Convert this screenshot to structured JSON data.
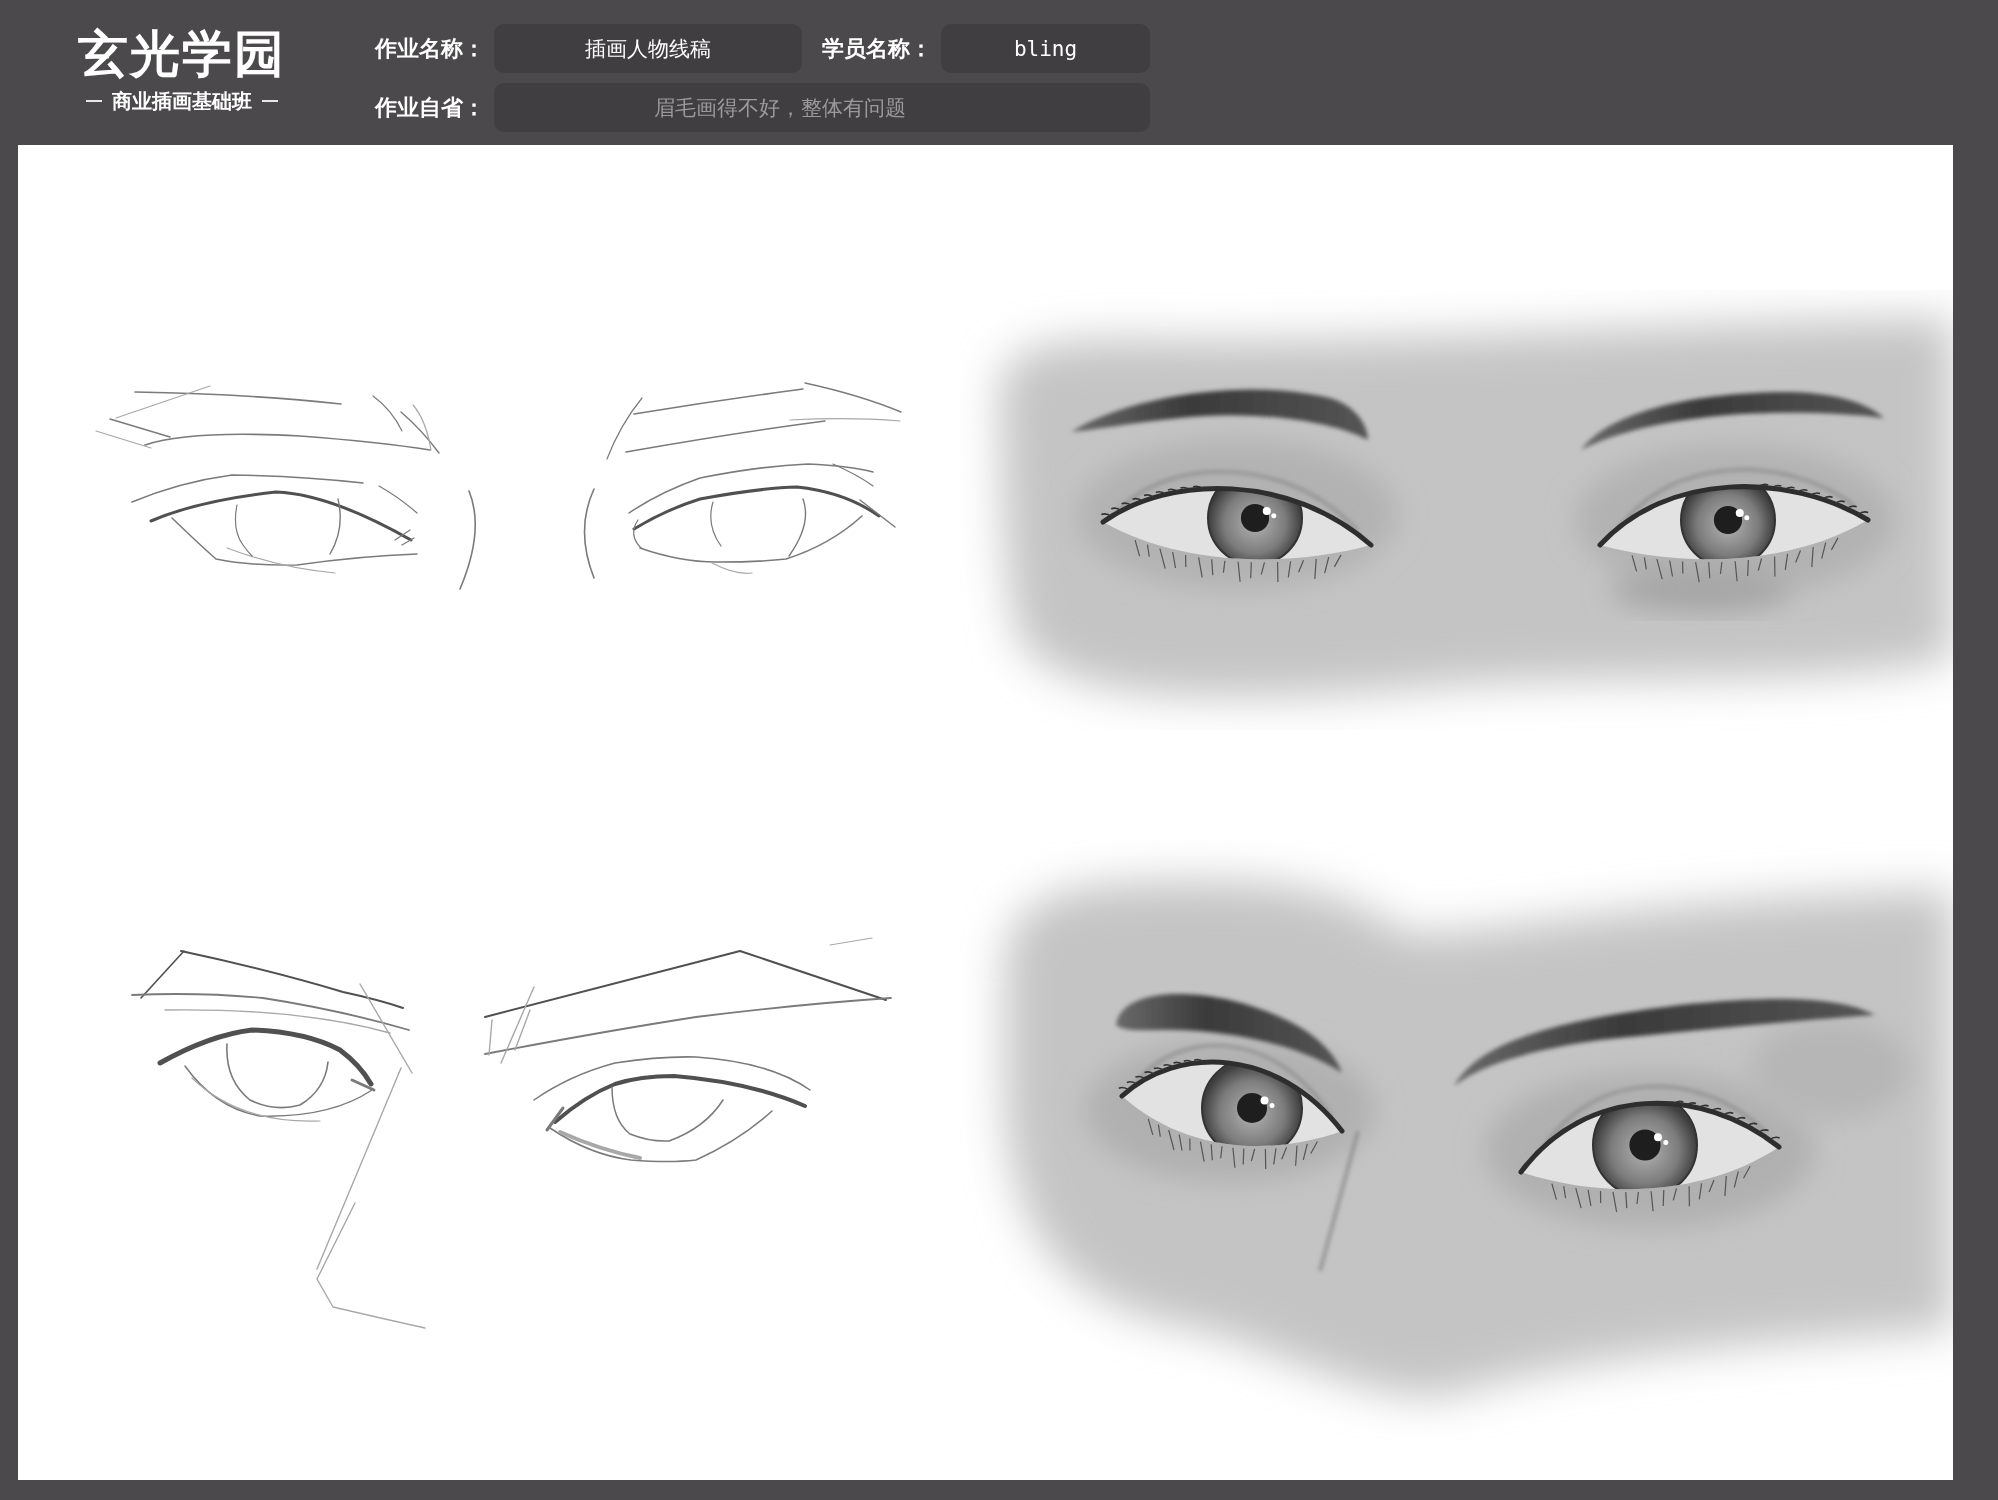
{
  "logo": {
    "title": "玄光学园",
    "subtitle": "商业插画基础班"
  },
  "fields": [
    {
      "label": "作业名称：",
      "value": "插画人物线稿",
      "kind": "short"
    },
    {
      "label": "学员名称：",
      "value": "bling",
      "kind": "short"
    },
    {
      "label": "作业自省：",
      "value": "眉毛画得不好，整体有问题",
      "kind": "note"
    }
  ]
}
